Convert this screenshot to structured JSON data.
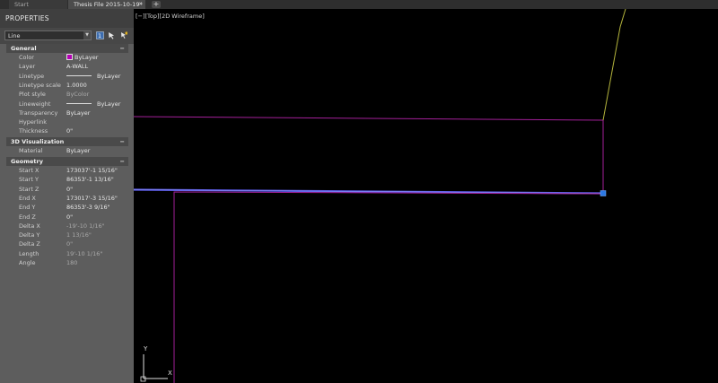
{
  "tabs": [
    {
      "label": "Start"
    },
    {
      "label": "Thesis File 2015-10-19*"
    }
  ],
  "tab_close_glyph": "×",
  "tab_add_glyph": "+",
  "panel": {
    "title": "PROPERTIES",
    "selector_value": "Line",
    "sections": [
      {
        "title": "General"
      },
      {
        "title": "3D Visualization"
      },
      {
        "title": "Geometry"
      }
    ],
    "collapse_glyph": "−",
    "general": [
      {
        "label": "Color",
        "value": "ByLayer"
      },
      {
        "label": "Layer",
        "value": "A-WALL"
      },
      {
        "label": "Linetype",
        "value": "ByLayer"
      },
      {
        "label": "Linetype scale",
        "value": "1.0000"
      },
      {
        "label": "Plot style",
        "value": "ByColor"
      },
      {
        "label": "Lineweight",
        "value": "ByLayer"
      },
      {
        "label": "Transparency",
        "value": "ByLayer"
      },
      {
        "label": "Hyperlink",
        "value": ""
      },
      {
        "label": "Thickness",
        "value": "0\""
      }
    ],
    "visualization": [
      {
        "label": "Material",
        "value": "ByLayer"
      }
    ],
    "geometry": [
      {
        "label": "Start X",
        "value": "173037'-1 15/16\""
      },
      {
        "label": "Start Y",
        "value": "86353'-1 13/16\""
      },
      {
        "label": "Start Z",
        "value": "0\""
      },
      {
        "label": "End X",
        "value": "173017'-3 15/16\""
      },
      {
        "label": "End Y",
        "value": "86353'-3 9/16\""
      },
      {
        "label": "End Z",
        "value": "0\""
      },
      {
        "label": "Delta X",
        "value": "-19'-10 1/16\""
      },
      {
        "label": "Delta Y",
        "value": "1 13/16\""
      },
      {
        "label": "Delta Z",
        "value": "0\""
      },
      {
        "label": "Length",
        "value": "19'-10 1/16\""
      },
      {
        "label": "Angle",
        "value": "180"
      }
    ]
  },
  "viewport": {
    "label": "[−][Top][2D Wireframe]",
    "ucs_y": "Y",
    "ucs_x": "X"
  },
  "colors": {
    "wall_magenta": "#a4209a",
    "selected_line": "#5a5ae6",
    "grip": "#2b78e4",
    "yellow_line": "#b4b43c",
    "color_swatch": "#b400b4"
  }
}
